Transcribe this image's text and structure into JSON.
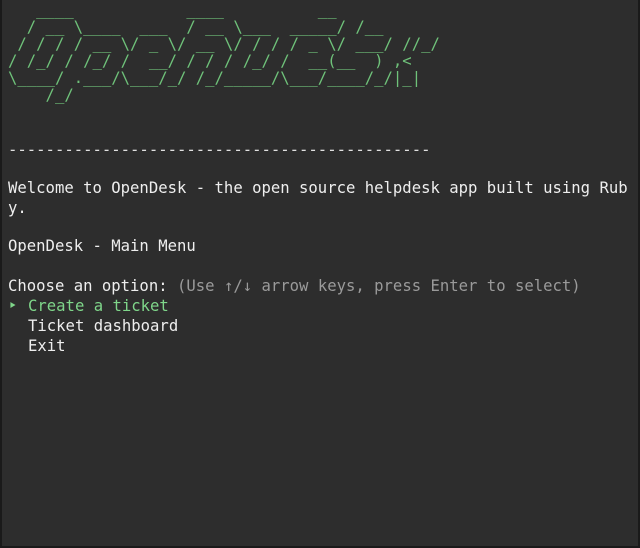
{
  "terminal": {
    "banner_lines": [
      "   ____            ____          __",
      "  / __ \\____  ___  / __ \\___  _____/ /__",
      " / / / / __ \\/ _ \\/ __ \\/ / / / _ \\/ ___/ //_/",
      "/ /_/ / /_/ /  __/ / / / /_/ /  __(__  ) ,<",
      "\\____/ .___/\\___/_/ /_/_____/\\___/____/_/|_|",
      "    /_/"
    ],
    "divider": "---------------------------------------------",
    "welcome_text": "Welcome to OpenDesk - the open source helpdesk app built using Ruby.",
    "menu_title": "OpenDesk - Main Menu",
    "prompt_label": "Choose an option:",
    "prompt_hint": "(Use ↑/↓ arrow keys, press Enter to select)",
    "selected_marker": "‣",
    "options": [
      {
        "label": "Create a ticket",
        "selected": true
      },
      {
        "label": "Ticket dashboard",
        "selected": false
      },
      {
        "label": "Exit",
        "selected": false
      }
    ]
  },
  "colors": {
    "background": "#2d2d2d",
    "text": "#eeeeee",
    "accent_green": "#7fd68a",
    "hint_gray": "#9a9a9a"
  }
}
